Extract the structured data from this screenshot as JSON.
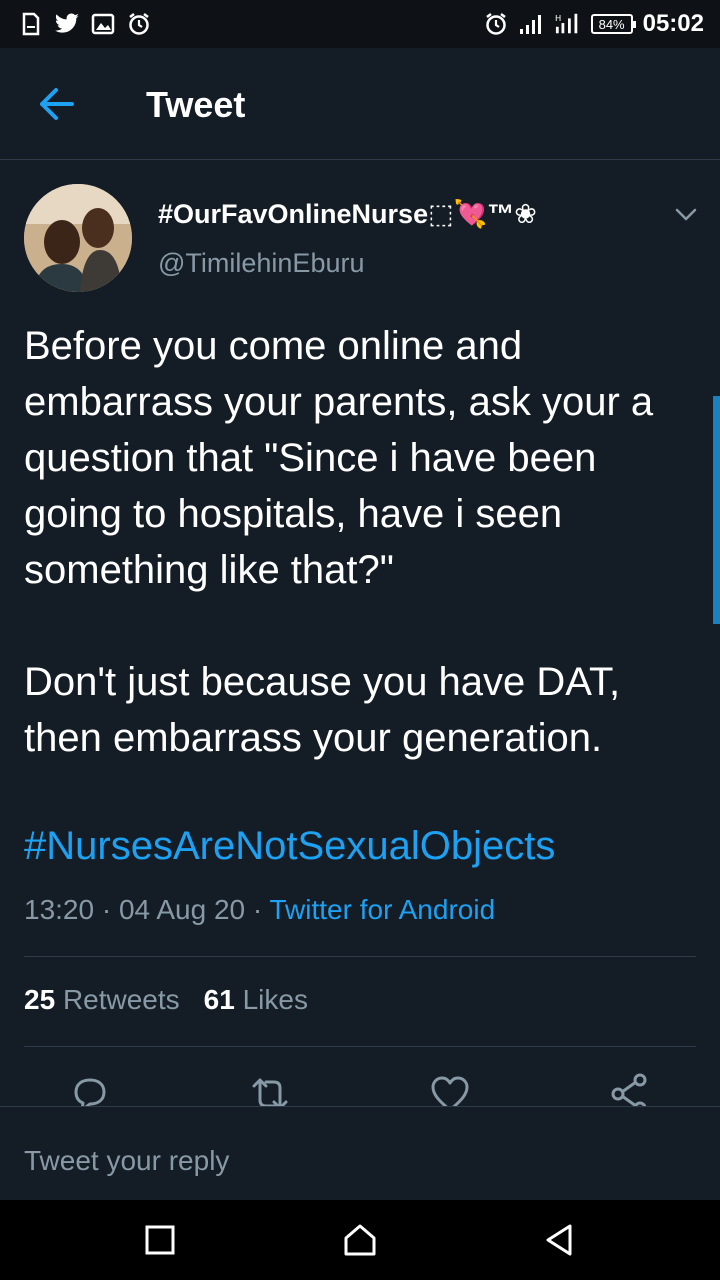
{
  "status_bar": {
    "time": "05:02",
    "battery": "84%",
    "left_icons": [
      "sim-icon",
      "twitter-icon",
      "gallery-icon",
      "alarm-icon"
    ],
    "right_icons": [
      "alarm-icon",
      "signal-icon",
      "signal-ht-icon",
      "battery-icon"
    ]
  },
  "header": {
    "title": "Tweet",
    "back_icon": "arrow-left-icon"
  },
  "tweet": {
    "display_name": "#OurFavOnlineNurse⬚💘™❀",
    "handle": "@TimilehinEburu",
    "text": "Before you come online and embarrass your parents, ask your a question that \"Since i have been going to hospitals, have i seen something like that?\"\n\nDon't just because you have DAT, then embarrass your generation.",
    "hashtag": "#NursesAreNotSexualObjects",
    "time": "13:20",
    "date": "04 Aug 20",
    "source": "Twitter for Android",
    "retweets_count": "25",
    "retweets_label": "Retweets",
    "likes_count": "61",
    "likes_label": "Likes"
  },
  "actions": [
    "reply-icon",
    "retweet-icon",
    "like-icon",
    "share-icon"
  ],
  "reply": {
    "placeholder": "Tweet your reply"
  },
  "colors": {
    "background": "#141d26",
    "accent": "#1da1f2",
    "secondary_text": "#8899a6",
    "divider": "#2f3b48"
  }
}
